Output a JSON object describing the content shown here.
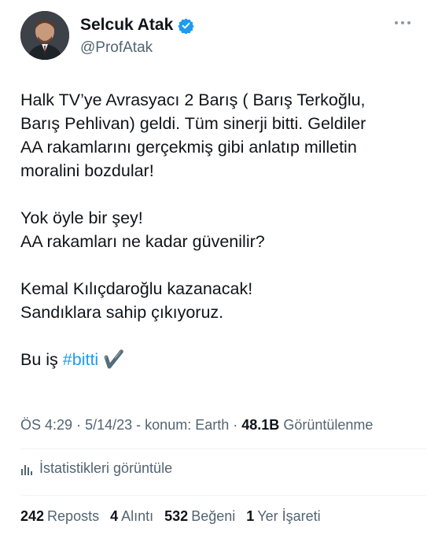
{
  "author": {
    "display_name": "Selcuk Atak",
    "handle": "@ProfAtak",
    "verified_icon": "verified-badge-icon",
    "verified_color": "#1d9bf0"
  },
  "tweet": {
    "paragraphs": [
      [
        "Halk TV’ye Avrasyacı 2 Barış ( Barış Terkoğlu,",
        "Barış Pehlivan) geldi. Tüm sinerji bitti. Geldiler",
        "AA rakamlarını gerçekmiş gibi anlatıp milletin",
        "moralini bozdular!"
      ],
      [
        "Yok öyle bir şey!",
        "AA rakamları ne kadar güvenilir?"
      ],
      [
        "Kemal Kılıçdaroğlu kazanacak!",
        "Sandıklara sahip çıkıyoruz."
      ]
    ],
    "last_line_prefix": "Bu iş ",
    "hashtag": "#bitti",
    "checkmark": "✔️"
  },
  "meta": {
    "time": "ÖS 4:29",
    "date": "5/14/23",
    "location": "konum: Earth",
    "views_count": "48.1B",
    "views_label": "Görüntülenme",
    "separator": "·",
    "dash": "-"
  },
  "stats_link": {
    "label": "İstatistikleri görüntüle",
    "icon": "analytics-icon"
  },
  "counts": {
    "reposts_value": "242",
    "reposts_label": "Reposts",
    "quotes_value": "4",
    "quotes_label": "Alıntı",
    "likes_value": "532",
    "likes_label": "Beğeni",
    "bookmarks_value": "1",
    "bookmarks_label": "Yer İşareti"
  },
  "colors": {
    "text": "#0f1419",
    "secondary": "#536471",
    "link": "#1d9bf0"
  }
}
